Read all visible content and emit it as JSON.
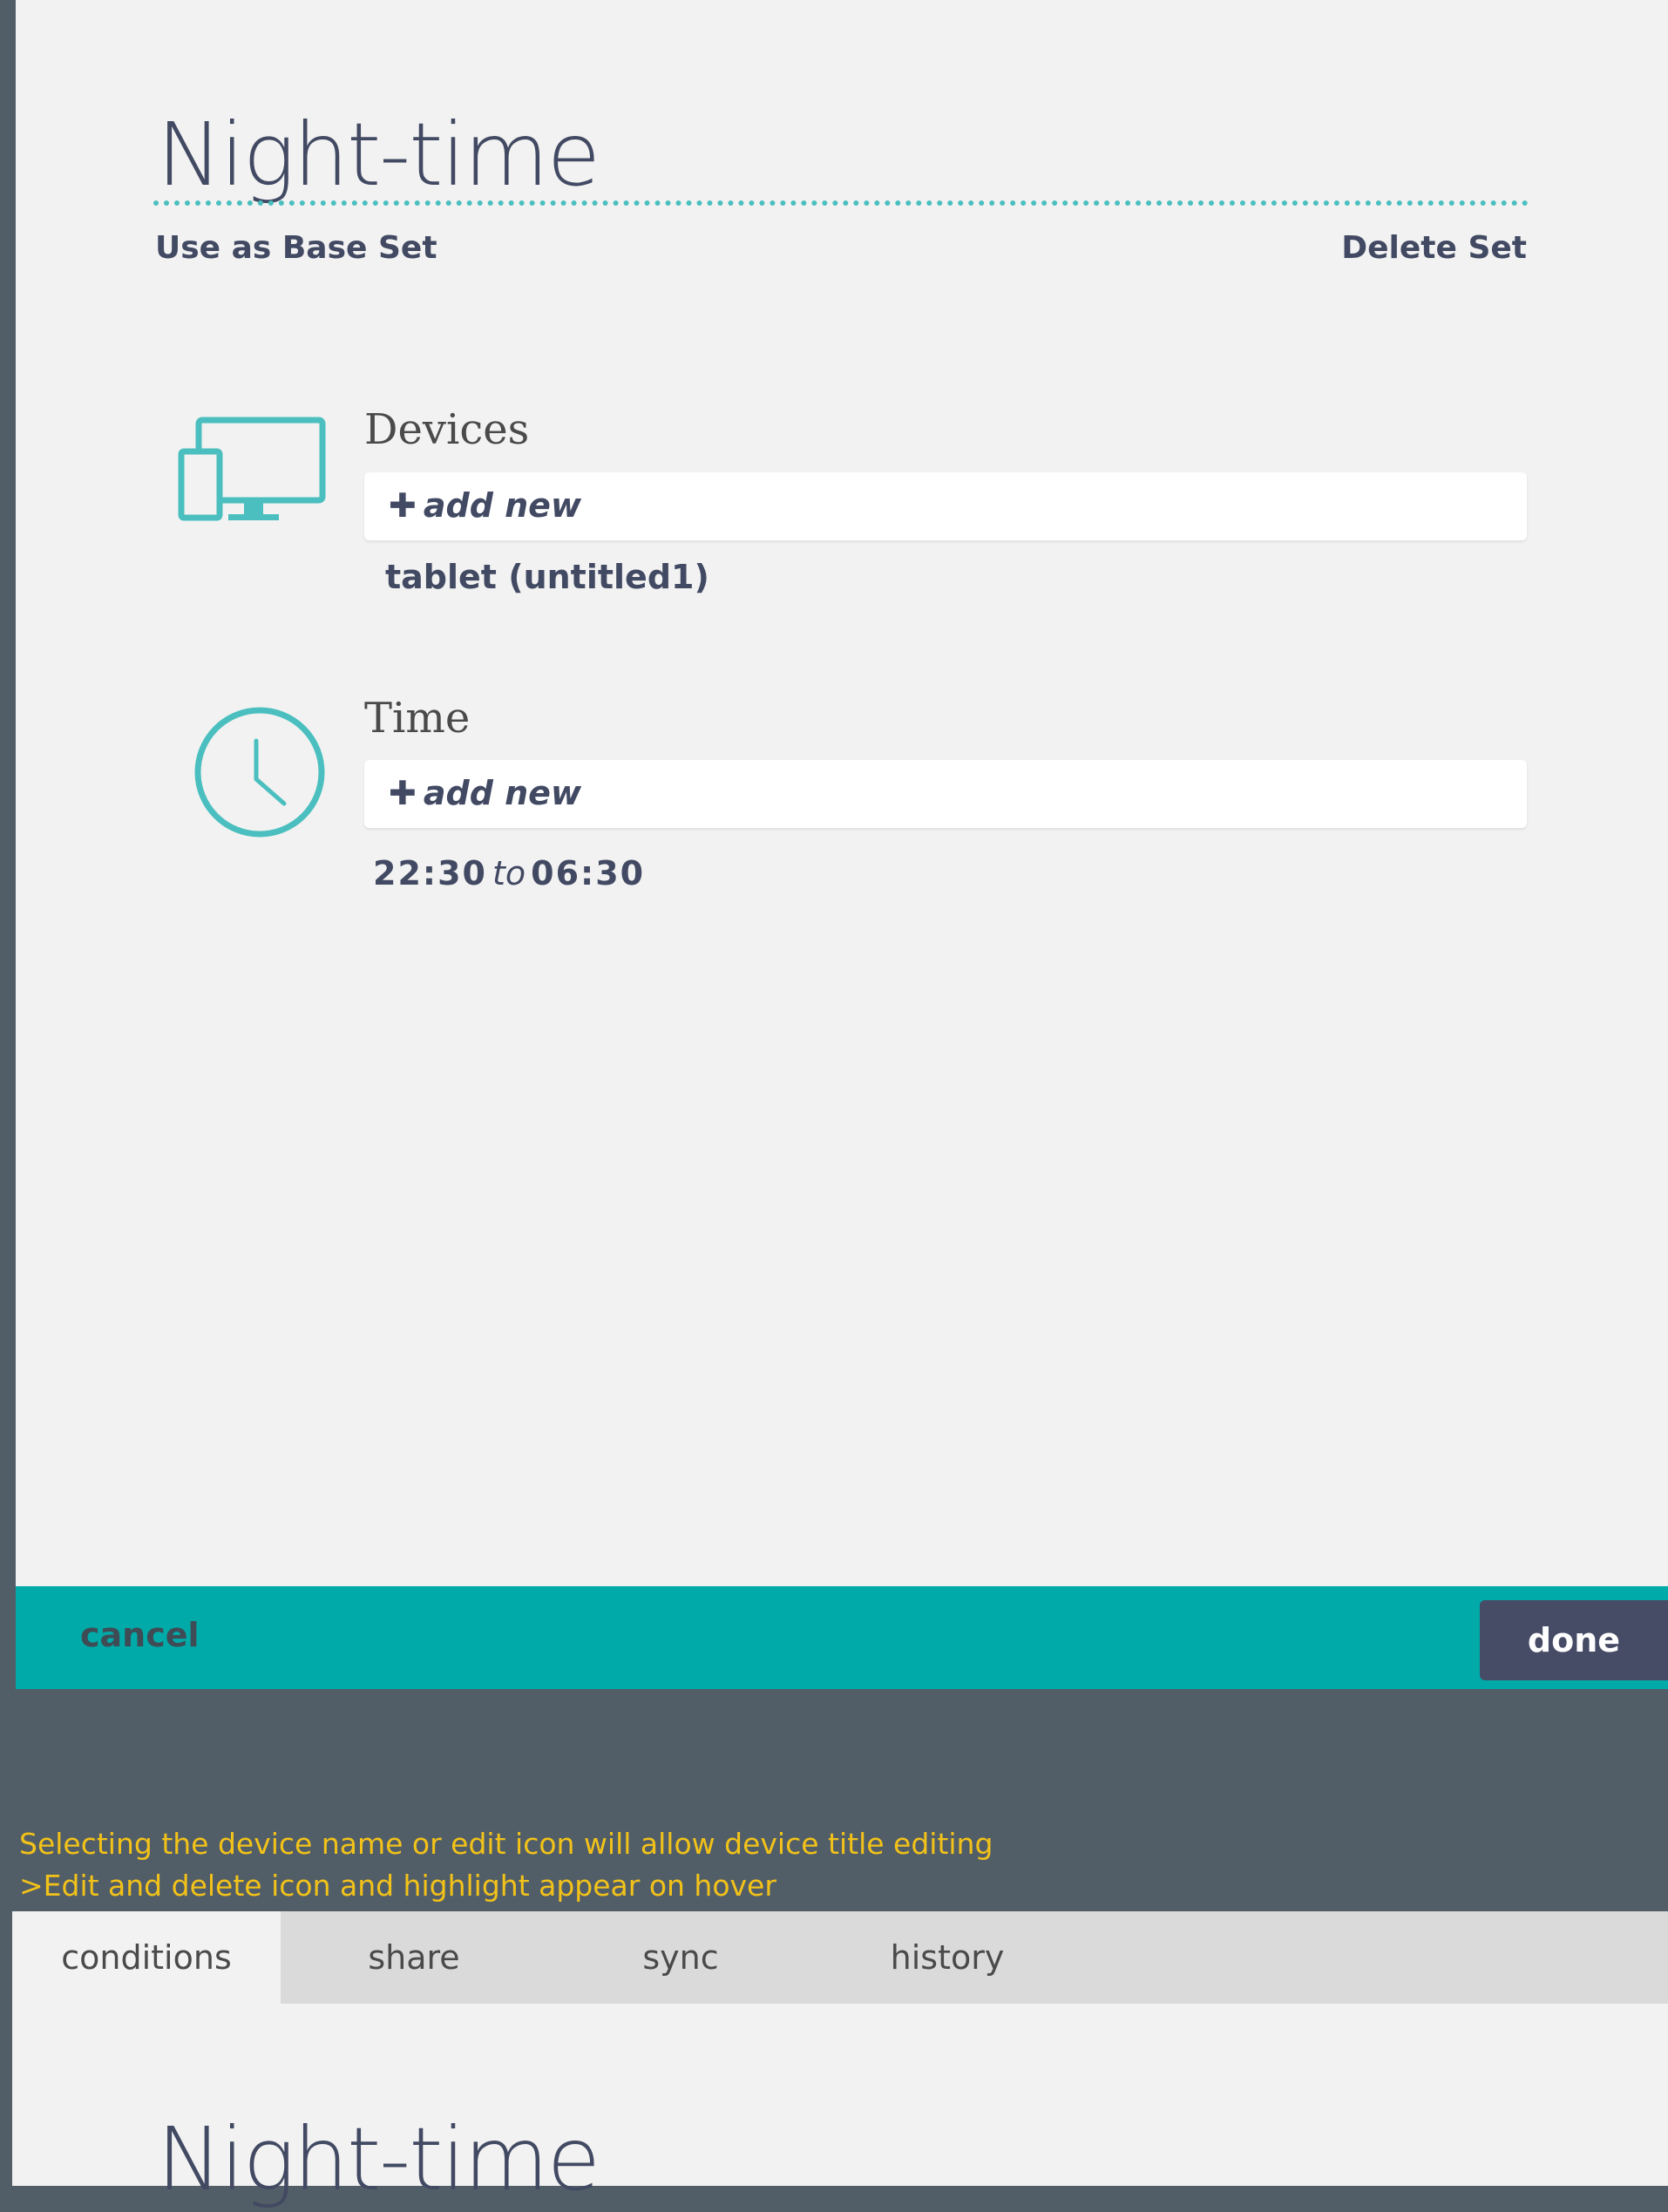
{
  "set": {
    "title": "Night-time",
    "use_as_base_label": "Use as Base Set",
    "delete_label": "Delete Set"
  },
  "devices": {
    "heading": "Devices",
    "add_new_label": "add new",
    "items": [
      "tablet (untitled1)"
    ]
  },
  "time": {
    "heading": "Time",
    "add_new_label": "add new",
    "from": "22:30",
    "to_word": "to",
    "to": "06:30"
  },
  "actions": {
    "cancel_label": "cancel",
    "done_label": "done"
  },
  "notes": [
    "Selecting the device name or edit icon will allow device title editing",
    ">Edit and delete icon and highlight appear on hover"
  ],
  "tabs": [
    {
      "label": "conditions",
      "active": true
    },
    {
      "label": "share",
      "active": false
    },
    {
      "label": "sync",
      "active": false
    },
    {
      "label": "history",
      "active": false
    }
  ],
  "colors": {
    "accent": "#4bbfbf",
    "action_bar": "#00aaa8",
    "done_button": "#464c66",
    "note_text": "#f2c219",
    "background": "#525e67",
    "panel": "#f2f2f2"
  },
  "icons": {
    "devices": "devices-icon",
    "time": "clock-icon",
    "plus": "plus-icon"
  }
}
